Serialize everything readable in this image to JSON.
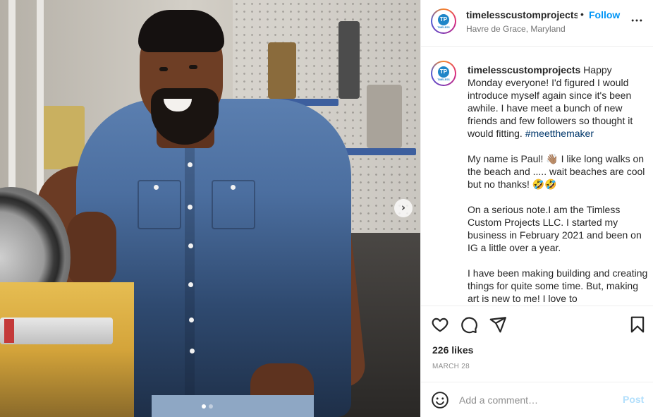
{
  "post": {
    "username": "timelesscustomprojects",
    "username_truncated": "timelesscustomprojects",
    "separator": "•",
    "follow_label": "Follow",
    "location": "Havre de Grace, Maryland",
    "caption_text": " Happy Monday everyone! I'd figured I would introduce myself again since it's been awhile. I have meet a bunch of new friends and few followers so thought it would fitting. ",
    "hashtag": "#meetthemaker",
    "caption_more": "\n\nMy name is Paul! 👋🏽 I like long walks on the beach and ..... wait beaches are cool but no thanks! 🤣🤣\n\nOn a serious note.I am the Timless Custom Projects LLC. I started my business in February 2021 and been on IG a little over a year.\n\nI have been making building and creating things for quite some time. But, making art is new to me! I love to",
    "likes": "226 likes",
    "date": "MARCH 28",
    "avatar_letters": "TP",
    "avatar_text": "TIMELESS"
  },
  "comment": {
    "placeholder": "Add a comment…",
    "post_label": "Post"
  },
  "carousel": {
    "next_glyph": "›",
    "slide_count": 2,
    "active_slide": 1
  },
  "icons": {
    "like": "heart-icon",
    "comment": "comment-icon",
    "share": "share-icon",
    "save": "bookmark-icon",
    "more": "more-options-icon",
    "emoji": "emoji-icon"
  },
  "colors": {
    "accent": "#0095f6",
    "hashtag": "#00376b",
    "post_disabled": "#b2dffc",
    "muted": "#8e8e8e"
  }
}
